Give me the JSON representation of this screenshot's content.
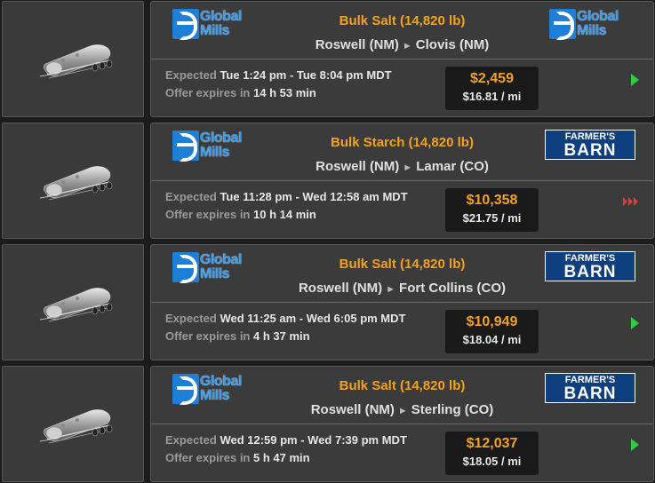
{
  "jobs": [
    {
      "source_company": "Global Mills",
      "cargo": "Bulk Salt (14,820 lb)",
      "origin": "Roswell (NM)",
      "destination": "Clovis (NM)",
      "expected_label": "Expected",
      "expected": "Tue 1:24 pm - Tue 8:04 pm MDT",
      "offer_label": "Offer expires in",
      "offer": "14 h 53 min",
      "total": "$2,459",
      "rate": "$16.81 / mi",
      "dest_company": "Global Mills",
      "urgency": "normal"
    },
    {
      "source_company": "Global Mills",
      "cargo": "Bulk Starch (14,820 lb)",
      "origin": "Roswell (NM)",
      "destination": "Lamar (CO)",
      "expected_label": "Expected",
      "expected": "Tue 11:28 pm - Wed 12:58 am MDT",
      "offer_label": "Offer expires in",
      "offer": "10 h 14 min",
      "total": "$10,358",
      "rate": "$21.75 / mi",
      "dest_company": "Farmer's Barn",
      "urgency": "urgent"
    },
    {
      "source_company": "Global Mills",
      "cargo": "Bulk Salt (14,820 lb)",
      "origin": "Roswell (NM)",
      "destination": "Fort Collins (CO)",
      "expected_label": "Expected",
      "expected": "Wed 11:25 am - Wed 6:05 pm MDT",
      "offer_label": "Offer expires in",
      "offer": "4 h 37 min",
      "total": "$10,949",
      "rate": "$18.04 / mi",
      "dest_company": "Farmer's Barn",
      "urgency": "normal"
    },
    {
      "source_company": "Global Mills",
      "cargo": "Bulk Salt (14,820 lb)",
      "origin": "Roswell (NM)",
      "destination": "Sterling (CO)",
      "expected_label": "Expected",
      "expected": "Wed 12:59 pm - Wed 7:39 pm MDT",
      "offer_label": "Offer expires in",
      "offer": "5 h 47 min",
      "total": "$12,037",
      "rate": "$18.05 / mi",
      "dest_company": "Farmer's Barn",
      "urgency": "normal"
    }
  ],
  "logos": {
    "global_mills_line1": "Global",
    "global_mills_line2": "Mills",
    "farmers_barn_line1": "FARMER'S",
    "farmers_barn_line2": "BARN"
  },
  "colors": {
    "accent_orange": "#f4a21b",
    "go_green": "#2ecc40",
    "urgent_red": "#e23b3b"
  }
}
